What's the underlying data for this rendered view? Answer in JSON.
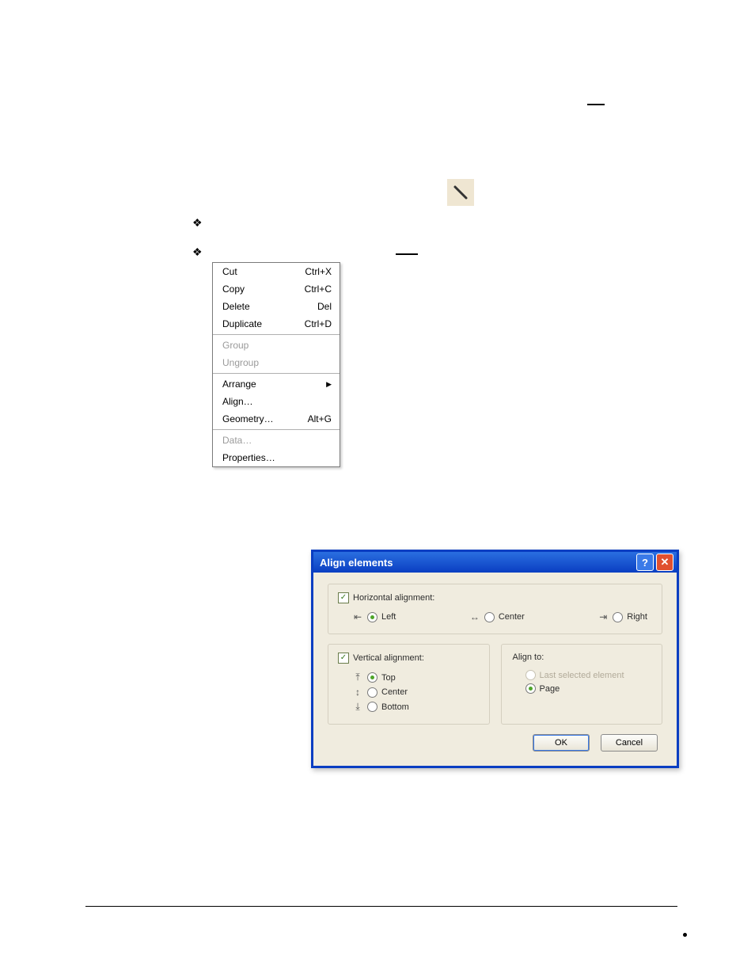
{
  "bullets": [
    "❖",
    "❖"
  ],
  "context_menu": {
    "items": [
      {
        "label": "Cut",
        "shortcut": "Ctrl+X",
        "disabled": false
      },
      {
        "label": "Copy",
        "shortcut": "Ctrl+C",
        "disabled": false
      },
      {
        "label": "Delete",
        "shortcut": "Del",
        "disabled": false
      },
      {
        "label": "Duplicate",
        "shortcut": "Ctrl+D",
        "disabled": false
      }
    ],
    "items2": [
      {
        "label": "Group",
        "shortcut": "",
        "disabled": true
      },
      {
        "label": "Ungroup",
        "shortcut": "",
        "disabled": true
      }
    ],
    "items3": [
      {
        "label": "Arrange",
        "shortcut": "",
        "submenu": true,
        "disabled": false
      },
      {
        "label": "Align…",
        "shortcut": "",
        "disabled": false
      },
      {
        "label": "Geometry…",
        "shortcut": "Alt+G",
        "disabled": false
      }
    ],
    "items4": [
      {
        "label": "Data…",
        "shortcut": "",
        "disabled": true
      },
      {
        "label": "Properties…",
        "shortcut": "",
        "disabled": false
      }
    ]
  },
  "dialog": {
    "title": "Align elements",
    "h_group": {
      "checkbox": "Horizontal alignment:",
      "checked": true,
      "options": [
        {
          "glyph": "⇤",
          "label": "Left",
          "selected": true
        },
        {
          "glyph": "↔",
          "label": "Center",
          "selected": false
        },
        {
          "glyph": "⇥",
          "label": "Right",
          "selected": false
        }
      ]
    },
    "v_group": {
      "checkbox": "Vertical alignment:",
      "checked": true,
      "options": [
        {
          "glyph": "⤒",
          "label": "Top",
          "selected": true
        },
        {
          "glyph": "↕",
          "label": "Center",
          "selected": false
        },
        {
          "glyph": "⤓",
          "label": "Bottom",
          "selected": false
        }
      ]
    },
    "align_to": {
      "label": "Align to:",
      "options": [
        {
          "label": "Last selected element",
          "selected": false,
          "disabled": true
        },
        {
          "label": "Page",
          "selected": true,
          "disabled": false
        }
      ]
    },
    "buttons": {
      "ok": "OK",
      "cancel": "Cancel"
    }
  }
}
